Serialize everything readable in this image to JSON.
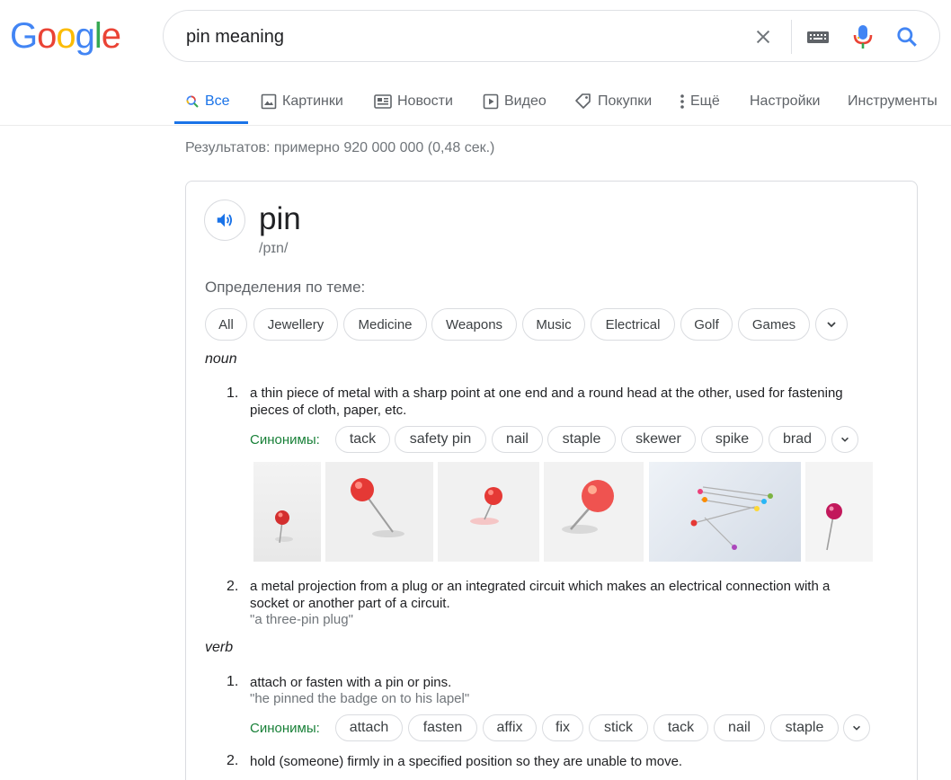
{
  "logo": {
    "letters": [
      "G",
      "o",
      "o",
      "g",
      "l",
      "e"
    ],
    "colors": [
      "#4285F4",
      "#EA4335",
      "#FBBC05",
      "#4285F4",
      "#34A853",
      "#EA4335"
    ]
  },
  "search": {
    "query": "pin meaning"
  },
  "tabs": [
    {
      "label": "Все",
      "icon": "search-icon"
    },
    {
      "label": "Картинки",
      "icon": "image-icon"
    },
    {
      "label": "Новости",
      "icon": "news-icon"
    },
    {
      "label": "Видео",
      "icon": "video-icon"
    },
    {
      "label": "Покупки",
      "icon": "tag-icon"
    },
    {
      "label": "Ещё",
      "icon": "more-vert-icon"
    },
    {
      "label": "Настройки",
      "icon": ""
    },
    {
      "label": "Инструменты",
      "icon": ""
    }
  ],
  "result_stats": "Результатов: примерно 920 000 000 (0,48 сек.)",
  "dictionary": {
    "word": "pin",
    "phonetic": "/pɪn/",
    "topics_title": "Определения по теме:",
    "topics": [
      "All",
      "Jewellery",
      "Medicine",
      "Weapons",
      "Music",
      "Electrical",
      "Golf",
      "Games"
    ],
    "noun_label": "noun",
    "noun_defs": [
      {
        "num": "1.",
        "line1": "a thin piece of metal with a sharp point at one end and a round head at the other, used for fastening",
        "line2": "pieces of cloth, paper, etc.",
        "synonyms_label": "Синонимы:",
        "synonyms": [
          "tack",
          "safety pin",
          "nail",
          "staple",
          "skewer",
          "spike",
          "brad"
        ]
      },
      {
        "num": "2.",
        "line1": "a metal projection from a plug or an integrated circuit which makes an electrical connection with a",
        "line2": "socket or another part of a circuit.",
        "example": "\"a three-pin plug\""
      }
    ],
    "verb_label": "verb",
    "verb_defs": [
      {
        "num": "1.",
        "line1": "attach or fasten with a pin or pins.",
        "example": "\"he pinned the badge on to his lapel\"",
        "synonyms_label": "Синонимы:",
        "synonyms": [
          "attach",
          "fasten",
          "affix",
          "fix",
          "stick",
          "tack",
          "nail",
          "staple"
        ]
      },
      {
        "num": "2.",
        "line1": "hold (someone) firmly in a specified position so they are unable to move."
      }
    ]
  },
  "colors": {
    "accent": "#1a73e8",
    "synonym_label": "#188038",
    "pin_red": "#e53935"
  }
}
